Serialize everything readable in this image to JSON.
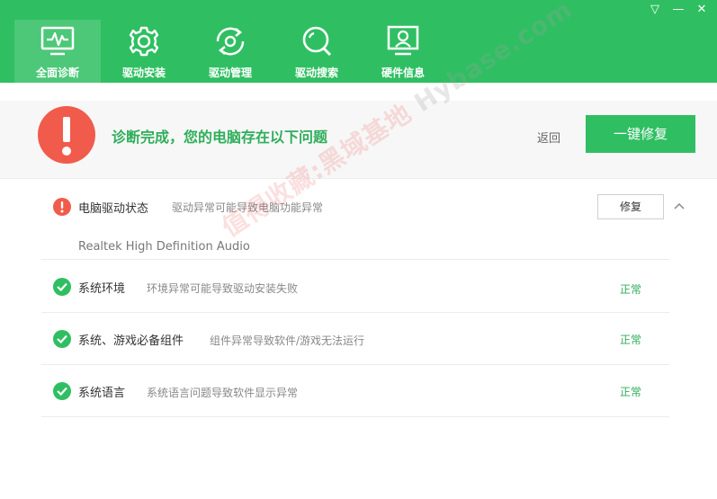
{
  "window_controls": {
    "menu": "▽",
    "minimize": "—",
    "close": "✕"
  },
  "nav": {
    "items": [
      {
        "label": "全面诊断",
        "icon": "monitor-pulse-icon",
        "active": true
      },
      {
        "label": "驱动安装",
        "icon": "gear-icon"
      },
      {
        "label": "驱动管理",
        "icon": "refresh-gear-icon"
      },
      {
        "label": "驱动搜索",
        "icon": "search-icon"
      },
      {
        "label": "硬件信息",
        "icon": "monitor-person-icon"
      }
    ]
  },
  "banner": {
    "alert_symbol": "!",
    "title": "诊断完成，您的电脑存在以下问题",
    "back_label": "返回",
    "fix_all_label": "一键修复"
  },
  "items": [
    {
      "name": "电脑驱动状态",
      "desc": "驱动异常可能导致电脑功能异常",
      "state": "error",
      "action_label": "修复",
      "devices": [
        "Realtek High Definition Audio"
      ]
    },
    {
      "name": "系统环境",
      "desc": "环境异常可能导致驱动安装失败",
      "state": "ok",
      "status": "正常"
    },
    {
      "name": "系统、游戏必备组件",
      "desc": "组件异常导致软件/游戏无法运行",
      "state": "ok",
      "status": "正常"
    },
    {
      "name": "系统语言",
      "desc": "系统语言问题导致软件显示异常",
      "state": "ok",
      "status": "正常"
    }
  ],
  "watermark": {
    "text": "值得收藏:黑域基地",
    "site": "Hybase.com"
  },
  "colors": {
    "brand_green": "#2fbf62",
    "text_green": "#2fae5a",
    "alert_red": "#f15b4b"
  }
}
